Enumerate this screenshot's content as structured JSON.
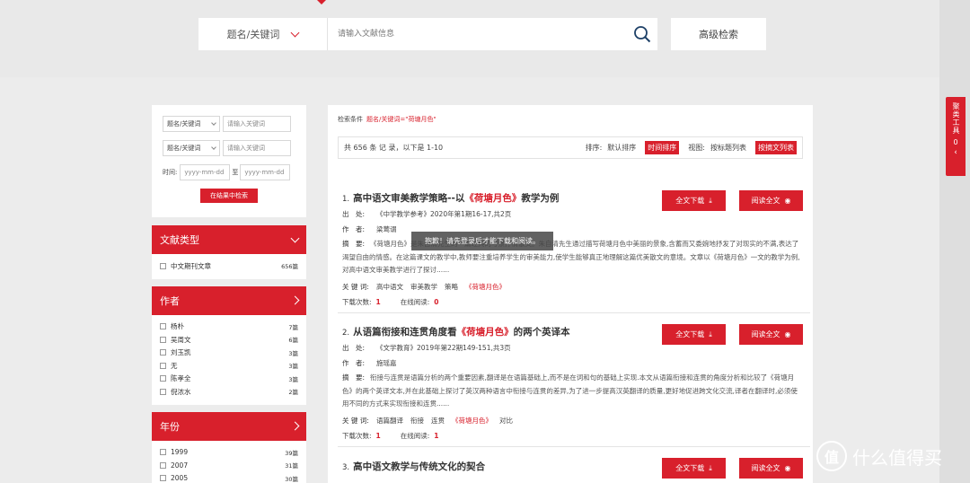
{
  "header": {
    "search_type": "题名/关键词",
    "search_placeholder": "请输入文献信息",
    "advanced_search": "高级检索"
  },
  "toolbox": {
    "label": "聚类工具",
    "count": "0",
    "arrow": "‹"
  },
  "left_filter": {
    "type1": "题名/关键词",
    "type2": "题名/关键词",
    "keyword_placeholder": "请输入关键词",
    "time_label": "时间:",
    "date_placeholder": "yyyy-mm-dd",
    "date_sep": "至",
    "search_in_results": "在结果中检索"
  },
  "sections": {
    "doc_type": {
      "title": "文献类型",
      "items": [
        {
          "name": "中文期刊文章",
          "count": "656篇"
        }
      ]
    },
    "author": {
      "title": "作者",
      "items": [
        {
          "name": "杨朴",
          "count": "7篇"
        },
        {
          "name": "吴周文",
          "count": "6篇"
        },
        {
          "name": "刘玉凯",
          "count": "3篇"
        },
        {
          "name": "无",
          "count": "3篇"
        },
        {
          "name": "陈孝全",
          "count": "3篇"
        },
        {
          "name": "倪浓水",
          "count": "2篇"
        }
      ]
    },
    "year": {
      "title": "年份",
      "items": [
        {
          "name": "1999",
          "count": "39篇"
        },
        {
          "name": "2007",
          "count": "31篇"
        },
        {
          "name": "2005",
          "count": "30篇"
        }
      ]
    }
  },
  "main": {
    "criteria_label": "检索条件",
    "criteria_value": "题名/关键词=\"荷塘月色\"",
    "result_summary": "共 656 条 记 录，以下是 1-10",
    "sort_label": "排序:",
    "sort_default": "默认排序",
    "sort_time": "时间排序",
    "view_label": "视图:",
    "view_title": "按标题列表",
    "view_abstract": "按摘文列表",
    "download_btn": "全文下载",
    "read_btn": "阅读全文",
    "label_source": "出　处:",
    "label_author": "作　者:",
    "label_abstract": "摘　要:",
    "label_keywords": "关 键 词:",
    "label_downloads": "下载次数:",
    "label_reads": "在线阅读:",
    "results": [
      {
        "num": "1.",
        "title_pre": "高中语文审美教学策略--以",
        "title_hl": "《荷塘月色》",
        "title_post": "教学为例",
        "source": "《中学教学参考》2020年第1期16-17,共2页",
        "author": "梁莺谓",
        "abstract": "《荷塘月色》是朱自清先生的一篇经典的写景抒情散文。朱自清先生通过描写荷塘月色中美丽的景象,含蓄而又委婉地抒发了对现实的不满,表达了渴望自由的情感。在这篇课文的教学中,教师要注重培养学生的审美能力,使学生能够真正地理解这篇优美散文的意境。文章以《荷塘月色》一文的教学为例,对高中语文审美教学进行了探讨......",
        "keywords": [
          "高中语文",
          "审美教学",
          "策略",
          "《荷塘月色》"
        ],
        "downloads": "1",
        "reads": "0"
      },
      {
        "num": "2.",
        "title_pre": "从语篇衔接和连贯角度看",
        "title_hl": "《荷塘月色》",
        "title_post": "的两个英译本",
        "source": "《文学教育》2019年第22期149-151,共3页",
        "author": "施瑶嘉",
        "abstract": "衔接与连贯是语篇分析的两个重要因素,翻译是在语篇基础上,而不是在词和句的基础上实现.本文从语篇衔接和连贯的角度分析和比较了《荷塘月色》的两个英译文本,并在此基础上探讨了英汉两种语言中衔接与连贯的差异,为了进一步提高汉英翻译的质量,更好地促进跨文化交流,译者在翻译时,必须使用不同的方式来实现衔接和连贯......",
        "keywords": [
          "语篇翻译",
          "衔接",
          "连贯",
          "《荷塘月色》",
          "对比"
        ],
        "downloads": "1",
        "reads": "1"
      },
      {
        "num": "3.",
        "title_pre": "高中语文教学与传统文化的契合",
        "title_hl": "",
        "title_post": "",
        "download": "全文下载",
        "read": "阅读全文"
      }
    ]
  },
  "toast": "抱歉！请先登录后才能下载和阅读。",
  "watermark": "什么值得买",
  "watermark_mark": "值"
}
